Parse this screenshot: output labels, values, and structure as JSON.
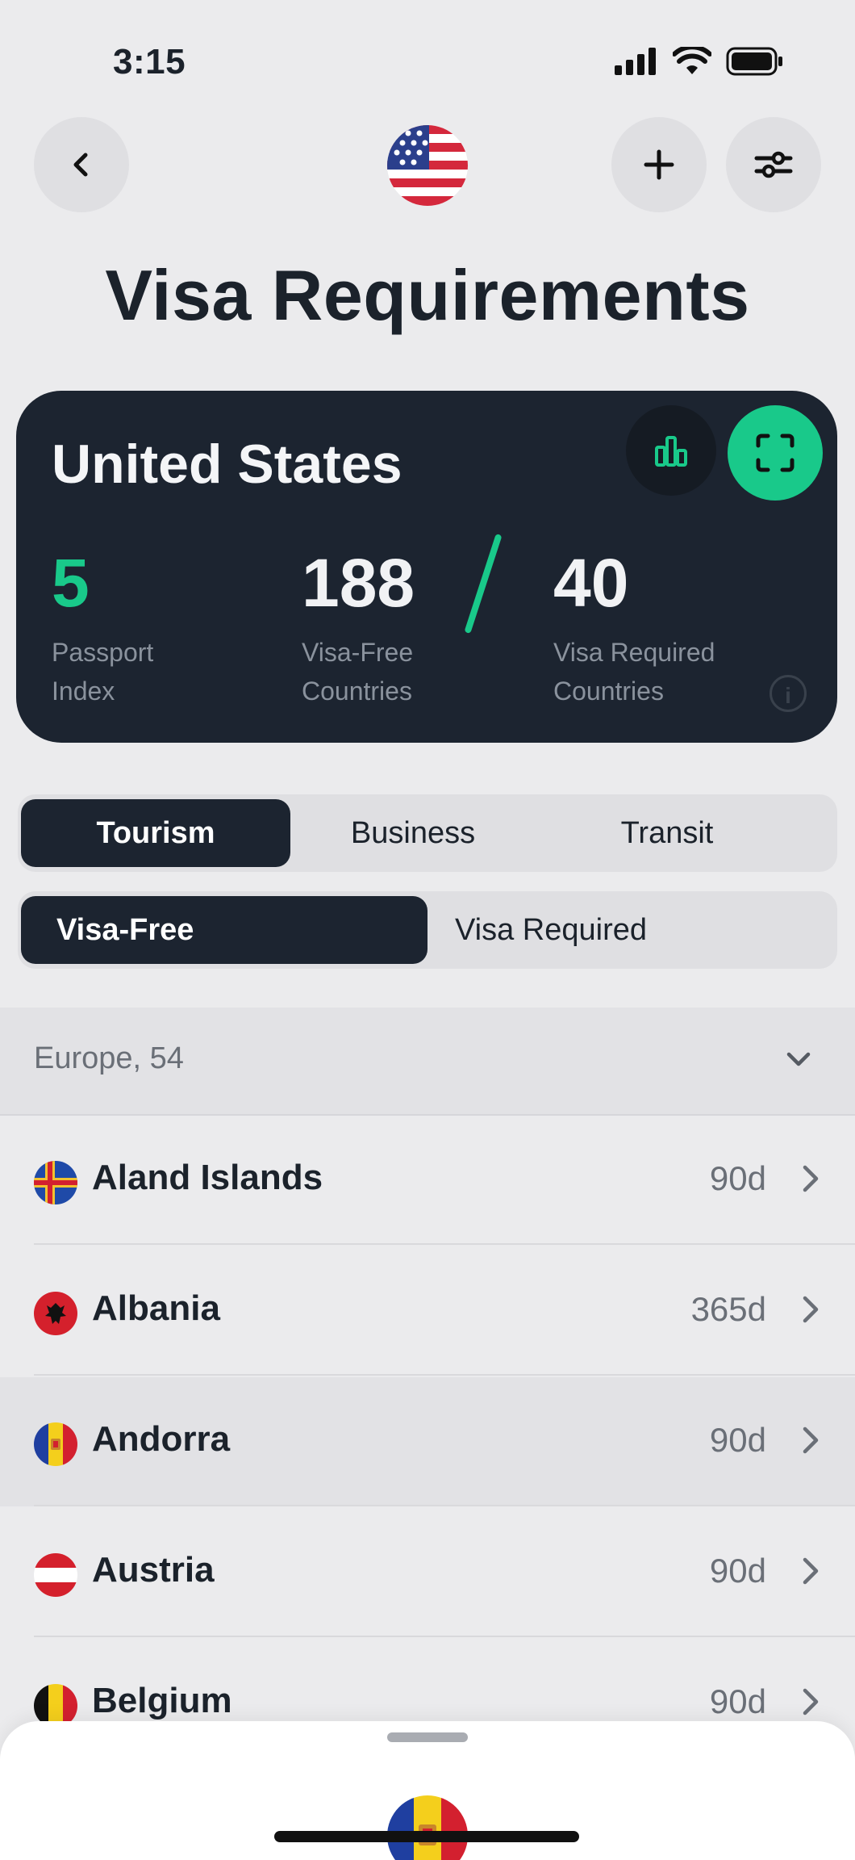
{
  "status_bar": {
    "time": "3:15"
  },
  "header": {
    "title": "Visa Requirements"
  },
  "card": {
    "country": "United States",
    "passport_index": {
      "value": "5",
      "label_line1": "Passport",
      "label_line2": "Index"
    },
    "visa_free": {
      "value": "188",
      "label_line1": "Visa-Free",
      "label_line2": "Countries"
    },
    "visa_required": {
      "value": "40",
      "label_line1": "Visa Required",
      "label_line2": "Countries"
    },
    "accent_color": "#19c98a"
  },
  "purpose_tabs": [
    {
      "label": "Tourism",
      "active": true
    },
    {
      "label": "Business",
      "active": false
    },
    {
      "label": "Transit",
      "active": false
    }
  ],
  "filter_tabs": [
    {
      "label": "Visa-Free",
      "active": true
    },
    {
      "label": "Visa Required",
      "active": false
    }
  ],
  "region": {
    "label": "Europe, 54"
  },
  "countries": [
    {
      "name": "Aland Islands",
      "days": "90d",
      "flag": "aland-flag"
    },
    {
      "name": "Albania",
      "days": "365d",
      "flag": "albania-flag"
    },
    {
      "name": "Andorra",
      "days": "90d",
      "flag": "andorra-flag"
    },
    {
      "name": "Austria",
      "days": "90d",
      "flag": "austria-flag"
    },
    {
      "name": "Belgium",
      "days": "90d",
      "flag": "belgium-flag"
    }
  ]
}
